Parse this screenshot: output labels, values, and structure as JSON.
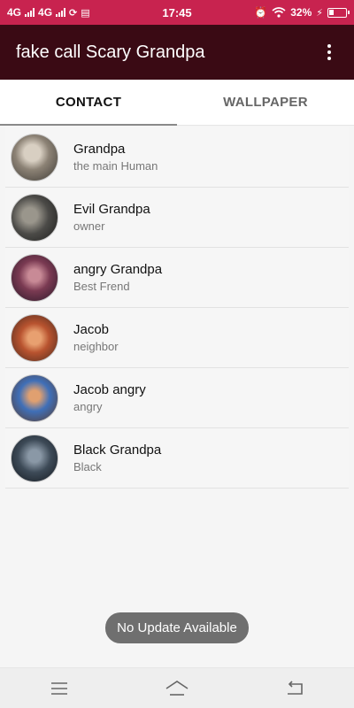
{
  "status_bar": {
    "network1": "4G",
    "network2": "4G",
    "time": "17:45",
    "battery": "32%",
    "colors": {
      "background": "#c8234f"
    }
  },
  "app_bar": {
    "title": "fake call Scary Grandpa",
    "menu_icon": "more-vert-icon",
    "colors": {
      "background": "#3a0a14"
    }
  },
  "tabs": [
    {
      "label": "CONTACT",
      "active": true
    },
    {
      "label": "WALLPAPER",
      "active": false
    }
  ],
  "contacts": [
    {
      "name": "Grandpa",
      "subtitle": "the main Human",
      "avatar_color": "#8c8275"
    },
    {
      "name": "Evil Grandpa",
      "subtitle": "owner",
      "avatar_color": "#4b4a47"
    },
    {
      "name": "angry Grandpa",
      "subtitle": "Best Frend",
      "avatar_color": "#7a3a52"
    },
    {
      "name": "Jacob",
      "subtitle": "neighbor",
      "avatar_color": "#b8532f"
    },
    {
      "name": "Jacob angry",
      "subtitle": "angry",
      "avatar_color": "#3f6fb8"
    },
    {
      "name": "Black Grandpa",
      "subtitle": "Black",
      "avatar_color": "#3d4a57"
    }
  ],
  "toast": {
    "text": "No Update Available"
  },
  "nav_bar": {
    "buttons": [
      "menu-icon",
      "home-icon",
      "back-icon"
    ]
  }
}
